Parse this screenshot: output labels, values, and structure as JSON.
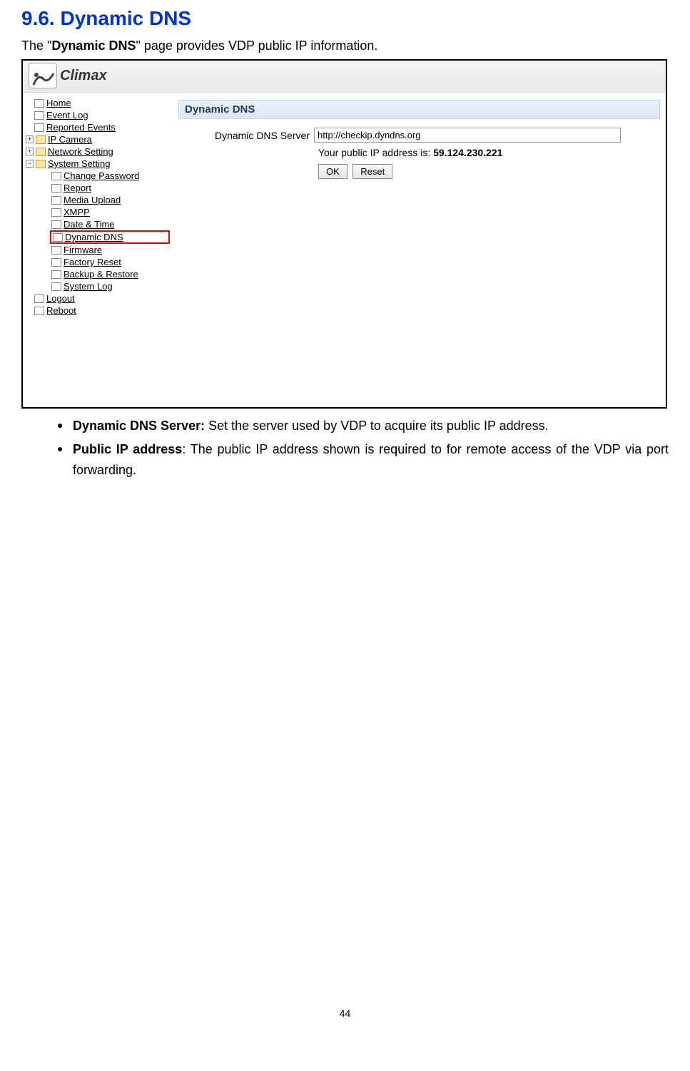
{
  "heading": "9.6. Dynamic DNS",
  "intro_pre": "The \"",
  "intro_bold": "Dynamic DNS",
  "intro_post": "\" page provides VDP public IP information.",
  "logo_text": "Climax",
  "panel_title": "Dynamic DNS",
  "form": {
    "server_label": "Dynamic DNS Server",
    "server_value": "http://checkip.dyndns.org",
    "ip_label": "Your public IP address is: ",
    "ip_value": "59.124.230.221",
    "ok_label": "OK",
    "reset_label": "Reset"
  },
  "tree": {
    "home": "Home",
    "event_log": "Event Log",
    "reported_events": "Reported Events",
    "ip_camera": "IP Camera",
    "network_setting": "Network Setting",
    "system_setting": "System Setting",
    "change_password": "Change Password",
    "report": "Report",
    "media_upload": "Media Upload",
    "xmpp": "XMPP",
    "date_time": "Date & Time",
    "dynamic_dns": "Dynamic DNS",
    "firmware": "Firmware",
    "factory_reset": "Factory Reset",
    "backup_restore": "Backup & Restore",
    "system_log": "System Log",
    "logout": "Logout",
    "reboot": "Reboot"
  },
  "bullets": {
    "b1_bold": "Dynamic DNS Server:",
    "b1_text": " Set the server used by VDP to acquire its public IP address.",
    "b2_bold": "Public IP address",
    "b2_text": ": The public IP address shown is required to for remote access of the VDP via port forwarding."
  },
  "page_number": "44"
}
